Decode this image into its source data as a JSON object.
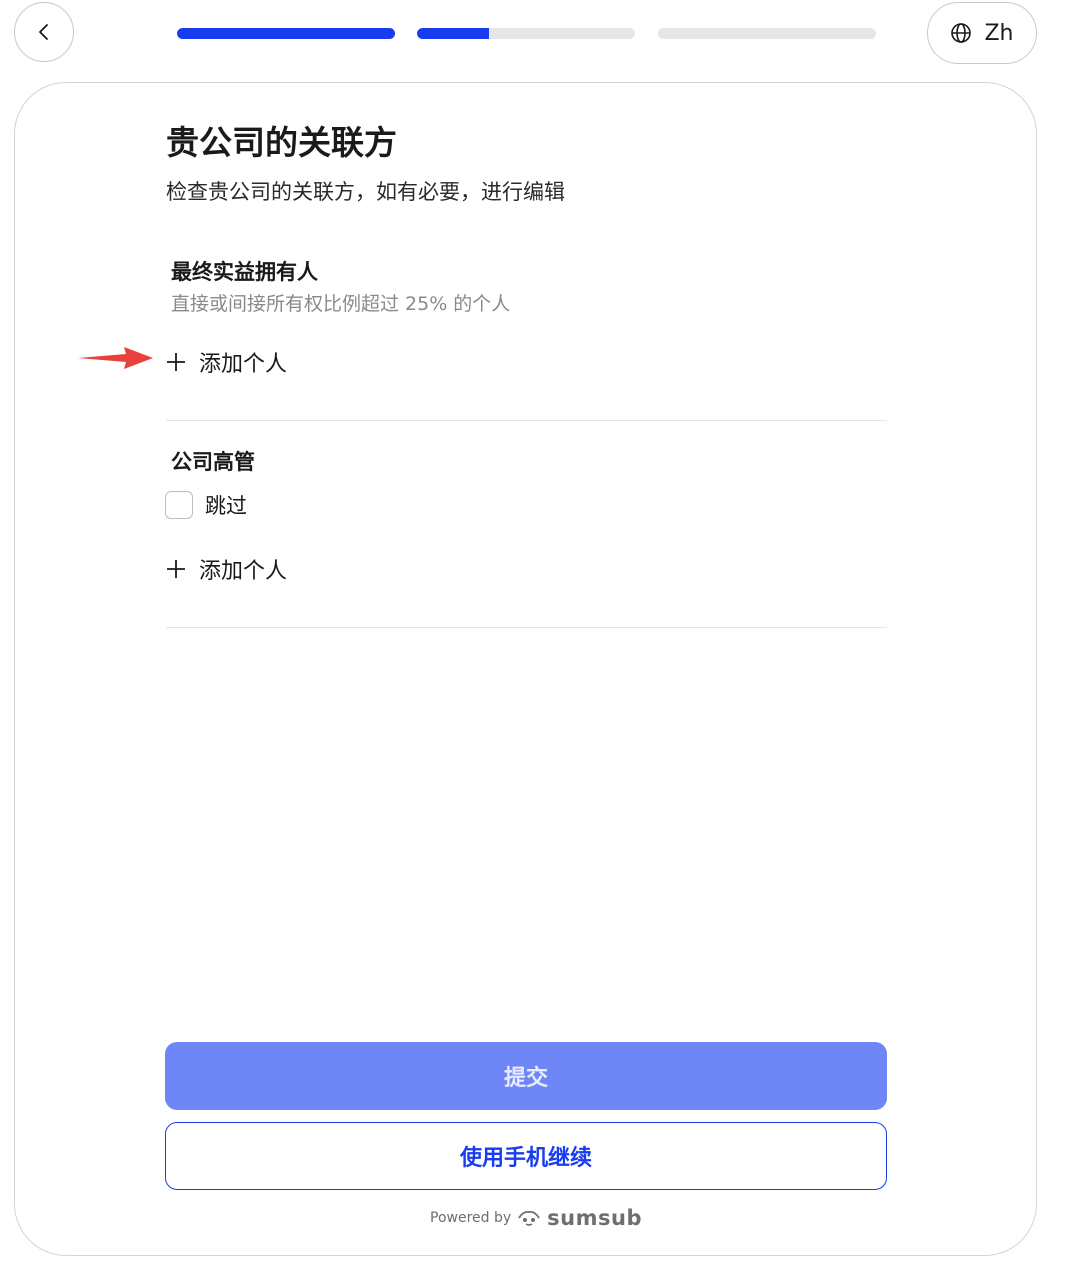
{
  "header": {
    "back_icon": "chevron-left-icon",
    "progress_steps": [
      {
        "fill_percent": 100
      },
      {
        "fill_percent": 33
      },
      {
        "fill_percent": 0
      }
    ],
    "language": {
      "icon": "globe-icon",
      "label": "Zh"
    }
  },
  "main": {
    "title": "贵公司的关联方",
    "subtitle": "检查贵公司的关联方，如有必要，进行编辑",
    "sections": [
      {
        "title": "最终实益拥有人",
        "description": "直接或间接所有权比例超过 25% 的个人",
        "add_label": "添加个人"
      },
      {
        "title": "公司高管",
        "skip_label": "跳过",
        "skip_checked": false,
        "add_label": "添加个人"
      }
    ]
  },
  "footer": {
    "submit_label": "提交",
    "mobile_label": "使用手机继续",
    "powered_by": "Powered by",
    "brand": "sumsub"
  },
  "colors": {
    "accent": "#1a3cf0",
    "submit_disabled": "#6f86f7",
    "annotation_arrow": "#e8413b"
  }
}
